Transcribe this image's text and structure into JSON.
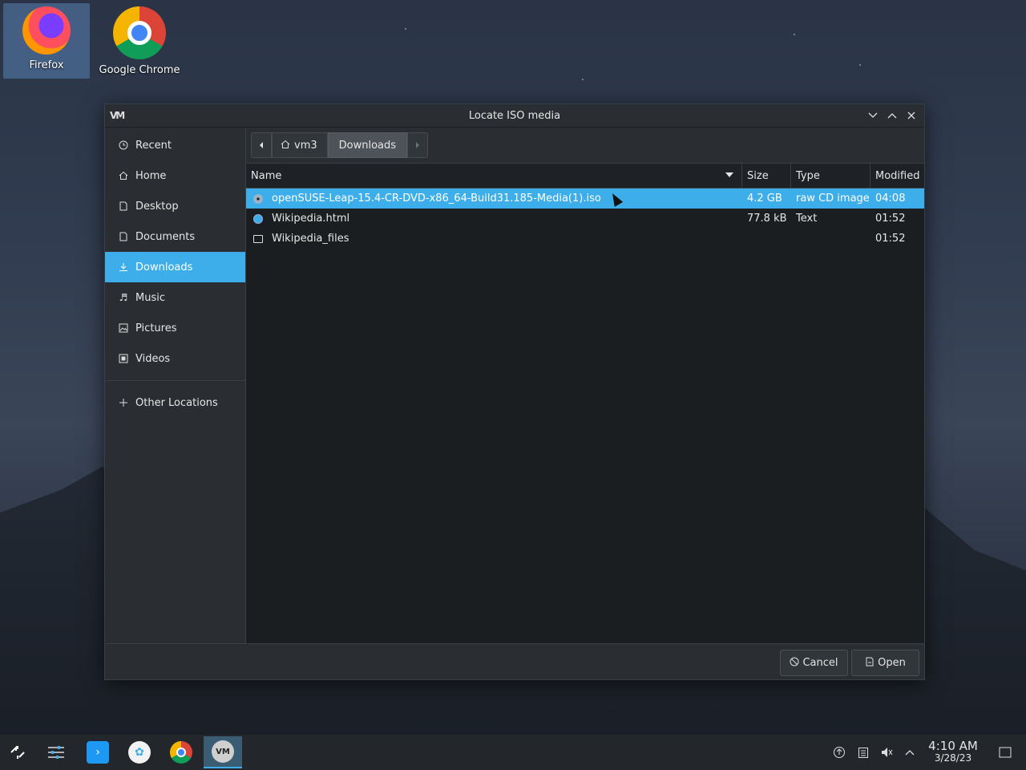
{
  "desktop": {
    "icons": [
      {
        "label": "Firefox"
      },
      {
        "label": "Google Chrome"
      }
    ]
  },
  "dialog": {
    "title": "Locate ISO media",
    "app_icon_text": "VM",
    "sidebar": {
      "items": [
        {
          "label": "Recent",
          "icon": "clock-icon",
          "active": false
        },
        {
          "label": "Home",
          "icon": "home-icon",
          "active": false
        },
        {
          "label": "Desktop",
          "icon": "desktop-icon",
          "active": false
        },
        {
          "label": "Documents",
          "icon": "documents-icon",
          "active": false
        },
        {
          "label": "Downloads",
          "icon": "download-icon",
          "active": true
        },
        {
          "label": "Music",
          "icon": "music-icon",
          "active": false
        },
        {
          "label": "Pictures",
          "icon": "pictures-icon",
          "active": false
        },
        {
          "label": "Videos",
          "icon": "videos-icon",
          "active": false
        }
      ],
      "other_locations": "Other Locations"
    },
    "pathbar": {
      "home_label": "vm3",
      "current_label": "Downloads"
    },
    "columns": {
      "name": "Name",
      "size": "Size",
      "type": "Type",
      "modified": "Modified"
    },
    "files": [
      {
        "name": "openSUSE-Leap-15.4-CR-DVD-x86_64-Build31.185-Media(1).iso",
        "size": "4.2 GB",
        "type": "raw CD image",
        "modified": "04:08",
        "icon": "disc-icon",
        "selected": true
      },
      {
        "name": "Wikipedia.html",
        "size": "77.8 kB",
        "type": "Text",
        "modified": "01:52",
        "icon": "globe-icon",
        "selected": false
      },
      {
        "name": "Wikipedia_files",
        "size": "",
        "type": "",
        "modified": "01:52",
        "icon": "folder-icon",
        "selected": false
      }
    ],
    "buttons": {
      "cancel": "Cancel",
      "open": "Open"
    }
  },
  "taskbar": {
    "clock_time": "4:10 AM",
    "clock_date": "3/28/23"
  },
  "colors": {
    "accent": "#3daee9",
    "dialog_bg": "#1b1e20",
    "panel_bg": "#2a2e32"
  }
}
